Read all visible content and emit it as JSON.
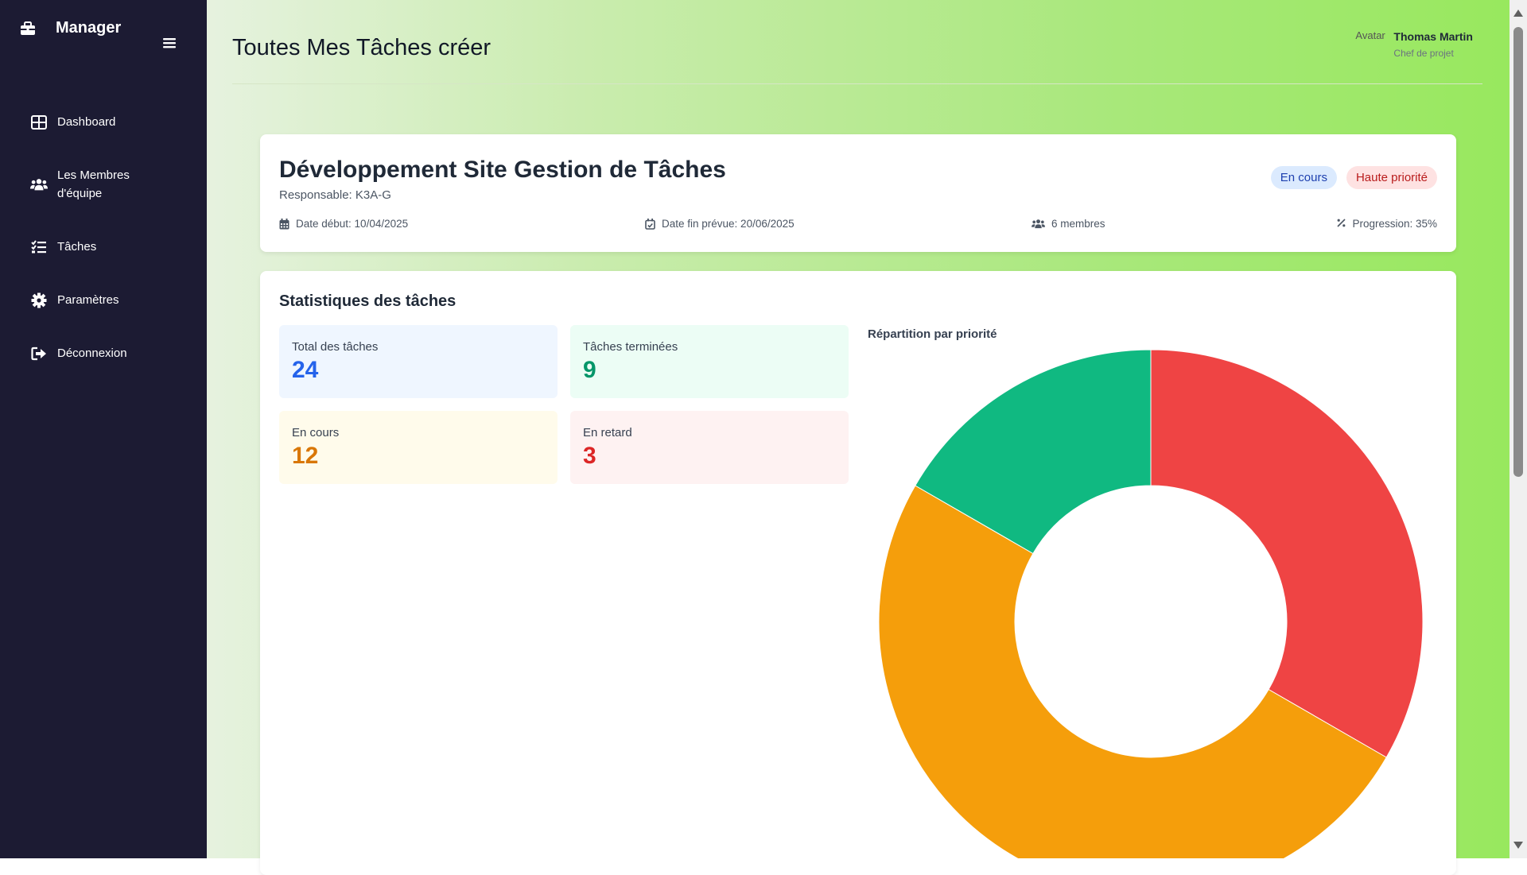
{
  "sidebar": {
    "brand": "Manager",
    "items": [
      {
        "label": "Dashboard",
        "icon": "dashboard-icon"
      },
      {
        "label": "Les Membres d'équipe",
        "icon": "users-icon"
      },
      {
        "label": "Tâches",
        "icon": "tasks-icon"
      },
      {
        "label": "Paramètres",
        "icon": "gear-icon"
      },
      {
        "label": "Déconnexion",
        "icon": "logout-icon"
      }
    ]
  },
  "header": {
    "title": "Toutes Mes Tâches créer",
    "user": {
      "name": "Thomas Martin",
      "role": "Chef de projet",
      "avatar_alt": "Avatar"
    }
  },
  "project": {
    "title": "Développement Site Gestion de Tâches",
    "responsable": "Responsable: K3A-G",
    "status_badge": "En cours",
    "priority_badge": "Haute priorité",
    "start": "Date début: 10/04/2025",
    "end": "Date fin prévue: 20/06/2025",
    "members": "6 membres",
    "progress": "Progression: 35%"
  },
  "stats": {
    "title": "Statistiques des tâches",
    "boxes": [
      {
        "label": "Total des tâches",
        "value": "24"
      },
      {
        "label": "Tâches terminées",
        "value": "9"
      },
      {
        "label": "En cours",
        "value": "12"
      },
      {
        "label": "En retard",
        "value": "3"
      }
    ],
    "chart_title": "Répartition par priorité"
  },
  "colors": {
    "sidebar": "#1c1b33",
    "accent_blue": "#2563eb",
    "green": "#10b981",
    "orange": "#f59e0b",
    "red": "#ef4444"
  },
  "chart_data": {
    "type": "pie",
    "donut": true,
    "values": [
      8,
      12,
      4
    ],
    "colors": [
      "#ef4444",
      "#f59e0b",
      "#10b981"
    ],
    "title": "Répartition par priorité"
  }
}
